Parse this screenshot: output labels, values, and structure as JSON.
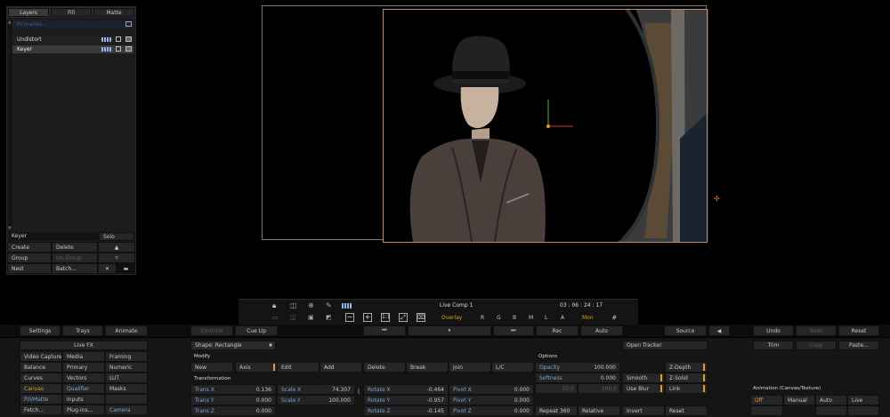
{
  "layers_panel": {
    "tabs": [
      "Layers",
      "Fill",
      "Matte"
    ],
    "rows": [
      {
        "label": "Primaries...",
        "selected": false
      },
      {
        "label": "Undistort",
        "selected": false
      },
      {
        "label": "Keyer",
        "selected": true
      }
    ],
    "name_field": "Keyer",
    "solo": "Solo",
    "create": "Create",
    "delete": "Delete",
    "group": "Group",
    "ungroup": "Un-Group",
    "nest": "Nest",
    "batch": "Batch..."
  },
  "viewer_bar": {
    "comp_name": "Live Comp 1",
    "timecode": "03 : 06 : 24 : 17",
    "overlay": "Overlay",
    "channels": [
      "R",
      "G",
      "B",
      "M",
      "L",
      "A"
    ],
    "mon": "Mon"
  },
  "toolbar": {
    "settings": "Settings",
    "trays": "Trays",
    "animate": "Animate",
    "controls": "Controls",
    "cue_up": "Cue Up",
    "rec": "Rec",
    "auto": "Auto",
    "source": "Source",
    "undo": "Undo",
    "redo": "Redo",
    "reset": "Reset",
    "trim": "Trim",
    "copy": "Copy",
    "paste": "Paste...",
    "open_tracker": "Open Tracker"
  },
  "fx_menu": {
    "header": "Live FX",
    "col1": [
      "Video Capture",
      "Balance",
      "Curves",
      "Canvas",
      "Fill/Matte",
      "Fetch..."
    ],
    "col2": [
      "Media",
      "Primary",
      "Vectors",
      "Qualifier",
      "Inputs",
      "Plug-ins..."
    ],
    "col3": [
      "Framing",
      "Numeric",
      "LUT",
      "Masks",
      "",
      "Camera"
    ]
  },
  "shape": {
    "dropdown": "Shape: Rectangle",
    "modify": "Modify",
    "buttons": [
      "New",
      "Axis",
      "Edit",
      "Add",
      "Delete",
      "Break",
      "Join",
      "L/C"
    ],
    "transformation": "Transformation"
  },
  "transform": {
    "trans_x": {
      "label": "Trans X",
      "value": "0.136"
    },
    "trans_y": {
      "label": "Trans Y",
      "value": "0.000"
    },
    "trans_z": {
      "label": "Trans Z",
      "value": "0.000"
    },
    "scale_x": {
      "label": "Scale X",
      "value": "74.307"
    },
    "scale_y": {
      "label": "Scale Y",
      "value": "100.000"
    },
    "rotate_x": {
      "label": "Rotate X",
      "value": "-0.464"
    },
    "rotate_y": {
      "label": "Rotate Y",
      "value": "-0.957"
    },
    "rotate_z": {
      "label": "Rotate Z",
      "value": "-0.145"
    },
    "pivot_x": {
      "label": "Pivot X",
      "value": "0.000"
    },
    "pivot_y": {
      "label": "Pivot Y",
      "value": "0.000"
    },
    "pivot_z": {
      "label": "Pivot Z",
      "value": "0.000"
    }
  },
  "options": {
    "header": "Options",
    "opacity": {
      "label": "Opacity",
      "value": "100.000"
    },
    "softness": {
      "label": "Softness",
      "value": "0.000"
    },
    "dim_left": "50.0",
    "dim_right": "100.0",
    "repeat": "Repeat 360",
    "relative": "Relative",
    "invert": "Invert",
    "reset": "Reset",
    "z_depth": "Z-Depth",
    "smooth": "Smooth",
    "z_solid": "Z-Solid",
    "use_blur": "Use Blur",
    "link": "Link"
  },
  "animation": {
    "header": "Animation (Canvas/Texture)",
    "buttons": [
      "Off",
      "Manual",
      "Auto",
      "Live"
    ]
  },
  "colors": {
    "accent_orange": "#e59a25",
    "label_blue": "#7fa3d6",
    "panel_bg": "#1c1c1c"
  }
}
